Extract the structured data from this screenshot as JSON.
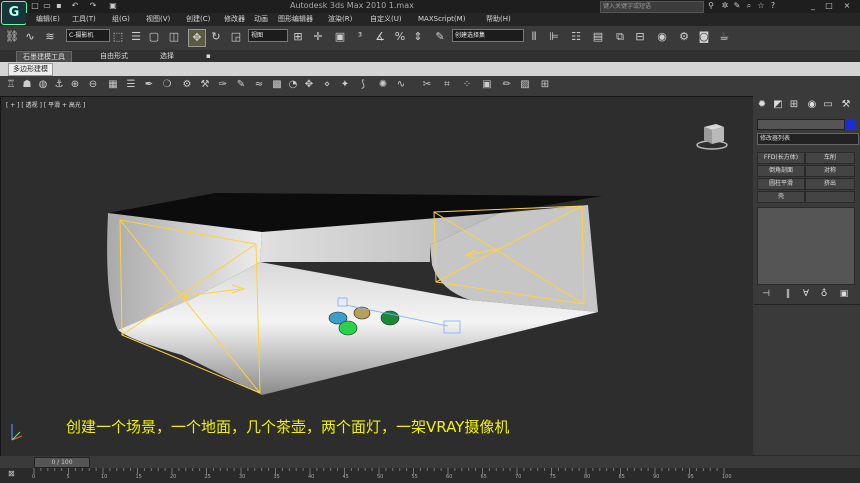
{
  "title_bar": {
    "window_title": "Autodesk 3ds Max  2010      1.max",
    "help_search_placeholder": "键入关键字或短语"
  },
  "menu": {
    "items": [
      "编辑(E)",
      "工具(T)",
      "组(G)",
      "视图(V)",
      "创建(C)",
      "修改器",
      "动画",
      "图形编辑器",
      "渲染(R)",
      "自定义(U)",
      "MAXScript(M)",
      "帮助(H)"
    ]
  },
  "main_toolbar": {
    "selection_filter": "C-摄影机",
    "reference_coord": "视图",
    "named_selection": "创建选择集"
  },
  "ribbon": {
    "tabs": [
      "石墨建模工具",
      "自由形式",
      "选择"
    ],
    "sub_tab": "多边形建模"
  },
  "viewport": {
    "label": "[ + ] [ 透视 ] [ 平滑 + 高光 ]",
    "caption": "创建一个场景，一个地面，几个茶壶，两个面灯，一架VRAY摄像机"
  },
  "command_panel": {
    "modifier_list": "修改器列表",
    "modifier_buttons": [
      "FFD(长方体)",
      "车削",
      "倒角剖面",
      "对称",
      "圆柱平滑",
      "挤出",
      "壳",
      ""
    ]
  },
  "timeline": {
    "slider_label": "0 / 100",
    "frames": [
      "0",
      "5",
      "10",
      "15",
      "20",
      "25",
      "30",
      "35",
      "40",
      "45",
      "50",
      "55",
      "60",
      "65",
      "70",
      "75",
      "80",
      "85",
      "90",
      "95",
      "100"
    ]
  },
  "colors": {
    "light_outline": "#ffd23c",
    "caption": "#f2f200",
    "color_swatch": "#1a2dd6"
  }
}
